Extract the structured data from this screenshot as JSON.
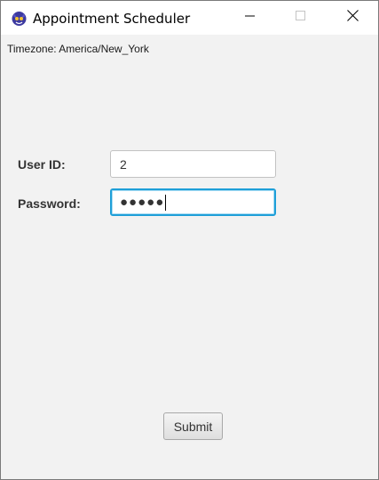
{
  "window": {
    "title": "Appointment Scheduler"
  },
  "header": {
    "timezone_text": "Timezone: America/New_York"
  },
  "form": {
    "user_id_label": "User ID:",
    "user_id_value": "2",
    "password_label": "Password:",
    "password_masked": "●●●●●",
    "submit_label": "Submit"
  },
  "icons": {
    "app": "app-logo-icon",
    "minimize": "minimize-icon",
    "maximize": "maximize-icon",
    "close": "close-icon"
  },
  "colors": {
    "focus_border": "#1e9fd8",
    "background": "#f2f2f2"
  }
}
